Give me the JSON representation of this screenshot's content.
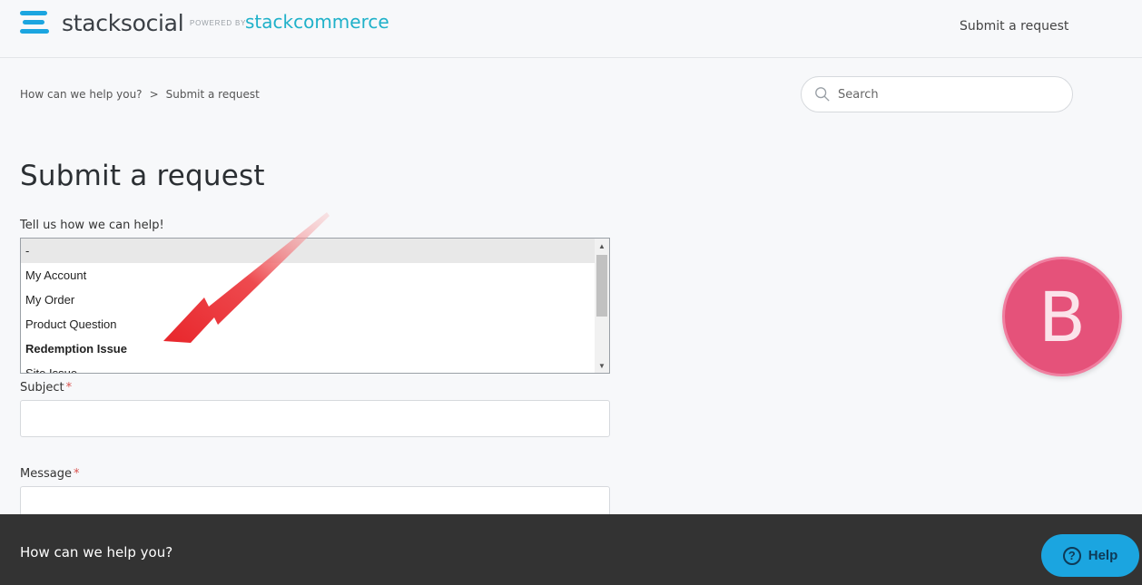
{
  "header": {
    "brand": "stacksocial",
    "powered_by": "POWERED BY",
    "partner": "stackcommerce",
    "nav_link": "Submit a request"
  },
  "breadcrumb": {
    "items": [
      "How can we help you?",
      "Submit a request"
    ],
    "separator": ">"
  },
  "search": {
    "placeholder": "Search"
  },
  "page_title": "Submit a request",
  "form": {
    "help_label": "Tell us how we can help!",
    "options": [
      "-",
      "My Account",
      "My Order",
      "Product Question",
      "Redemption Issue",
      "Site Issue"
    ],
    "selected_option": "-",
    "subject_label": "Subject",
    "message_label": "Message",
    "required_mark": "*"
  },
  "avatar": {
    "initial": "B",
    "color": "#e5527a"
  },
  "footer": {
    "text": "How can we help you?",
    "help_button": "Help"
  },
  "colors": {
    "brand_blue": "#1ba5e0",
    "partner_teal": "#1fb1c9",
    "arrow_red": "#e8262b"
  }
}
